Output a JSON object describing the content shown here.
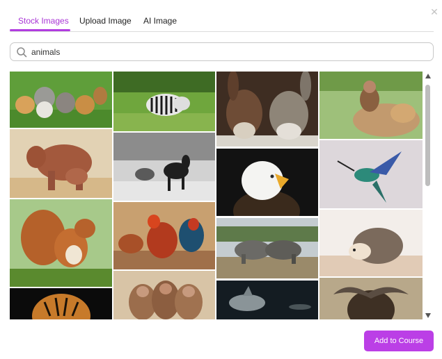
{
  "dialog": {
    "close_glyph": "✕"
  },
  "tabs": [
    {
      "label": "Stock Images",
      "active": true
    },
    {
      "label": "Upload Image",
      "active": false
    },
    {
      "label": "AI Image",
      "active": false
    }
  ],
  "search": {
    "value": "animals",
    "icon": "search-icon"
  },
  "gallery": {
    "items": [
      {
        "subject": "kittens",
        "column": 1
      },
      {
        "subject": "elephants",
        "column": 1
      },
      {
        "subject": "squirrel",
        "column": 1
      },
      {
        "subject": "tiger",
        "column": 1
      },
      {
        "subject": "zebras",
        "column": 2
      },
      {
        "subject": "horses",
        "column": 2
      },
      {
        "subject": "rooster",
        "column": 2
      },
      {
        "subject": "monkeys",
        "column": 2
      },
      {
        "subject": "donkeys",
        "column": 3
      },
      {
        "subject": "eagle",
        "column": 3
      },
      {
        "subject": "rhinos",
        "column": 3
      },
      {
        "subject": "shark",
        "column": 3
      },
      {
        "subject": "monkey",
        "column": 4
      },
      {
        "subject": "hummingbird",
        "column": 4
      },
      {
        "subject": "hedgehog",
        "column": 4
      },
      {
        "subject": "buffalo",
        "column": 4
      }
    ]
  },
  "footer": {
    "add_label": "Add to Course"
  },
  "colors": {
    "accent": "#b13ce0",
    "button": "#bb3fe6",
    "tab_active_text": "#a935d6"
  }
}
